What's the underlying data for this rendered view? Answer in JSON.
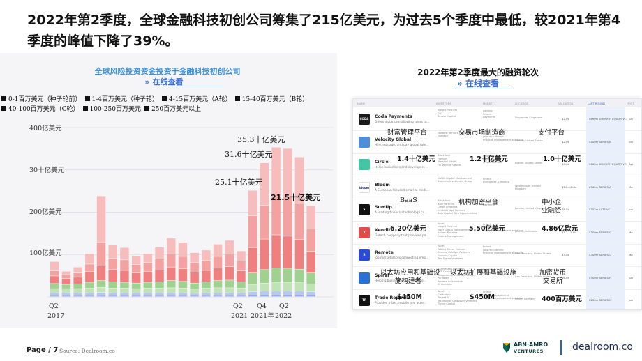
{
  "headline": "2022年第2季度，全球金融科技初创公司筹集了215亿美元，为过去5个季度中最低，较2021年第4季度的峰值下降了39%。",
  "left_chart": {
    "title": "全球风险投资资金投资于金融科技初创公司",
    "link": "» 在线查看",
    "legend": [
      "0-1百万美元（种子轮前）",
      "1-4百万美元（种子轮）",
      "4-15百万美元（A轮）",
      "15-40百万美元（B轮）",
      "40-100百万美元（C轮）",
      "100-250百万美元",
      "250百万美元以上"
    ],
    "y_ticks": [
      "400亿美元",
      "30十亿美元",
      "200亿美元",
      "100亿美元"
    ],
    "x_labels": [
      {
        "line1": "Q2",
        "line2": "2017"
      },
      {
        "line1": "Q2",
        "line2": "2021"
      },
      {
        "line1": "Q4",
        "line2": "2021年"
      },
      {
        "line1": "Q2",
        "line2": "2022"
      }
    ],
    "annotations": [
      "35.3十亿美元",
      "31.6十亿美元",
      "25.1十亿美元",
      "21.5十亿美元"
    ]
  },
  "chart_data": {
    "type": "bar",
    "stacked": true,
    "title": "全球风险投资资金投资于金融科技初创公司",
    "ylabel": "",
    "ylim": [
      0,
      40
    ],
    "unit": "十亿美元",
    "first_category": "Q2 2017",
    "last_category": "Q2 2022",
    "totals": [
      8.3,
      6.0,
      7.0,
      10.2,
      23.8,
      12.2,
      11.6,
      9.6,
      10.2,
      11.7,
      13.8,
      12.8,
      10.4,
      11.0,
      12.4,
      13.3,
      10.8,
      25.1,
      31.6,
      35.3,
      35.0,
      33.0,
      21.5
    ],
    "series": [
      {
        "name": "0-1百万美元（种子轮前）",
        "values": [
          0.3,
          0.3,
          0.3,
          0.3,
          0.3,
          0.3,
          0.3,
          0.3,
          0.3,
          0.3,
          0.3,
          0.3,
          0.3,
          0.3,
          0.3,
          0.3,
          0.3,
          0.4,
          0.4,
          0.4,
          0.4,
          0.4,
          0.4
        ]
      },
      {
        "name": "1-4百万美元（种子轮）",
        "values": [
          0.6,
          0.6,
          0.6,
          0.6,
          0.7,
          0.6,
          0.6,
          0.6,
          0.6,
          0.6,
          0.6,
          0.6,
          0.5,
          0.6,
          0.6,
          0.6,
          0.6,
          0.8,
          0.9,
          0.9,
          0.9,
          0.9,
          0.8
        ]
      },
      {
        "name": "4-15百万美元（A轮）",
        "values": [
          1.0,
          1.0,
          1.0,
          1.1,
          1.2,
          1.1,
          1.1,
          1.0,
          1.1,
          1.1,
          1.2,
          1.1,
          1.0,
          1.1,
          1.2,
          1.2,
          1.1,
          1.6,
          1.9,
          2.0,
          2.0,
          2.0,
          1.8
        ]
      },
      {
        "name": "15-40百万美元（B轮）",
        "values": [
          1.2,
          1.0,
          1.1,
          1.4,
          1.6,
          1.5,
          1.4,
          1.3,
          1.4,
          1.5,
          1.7,
          1.6,
          1.4,
          1.5,
          1.7,
          1.8,
          1.5,
          2.8,
          3.2,
          3.5,
          3.4,
          3.2,
          2.6
        ]
      },
      {
        "name": "40-100百万美元（C轮）",
        "values": [
          1.8,
          1.4,
          1.6,
          2.5,
          3.5,
          2.9,
          2.8,
          2.4,
          2.5,
          2.8,
          3.2,
          3.0,
          2.6,
          2.7,
          3.0,
          3.2,
          2.6,
          6.0,
          7.2,
          7.8,
          7.6,
          7.0,
          5.1
        ]
      },
      {
        "name": "100-250百万美元",
        "values": [
          1.2,
          0.9,
          1.0,
          1.8,
          5.5,
          2.7,
          2.5,
          2.0,
          2.2,
          2.6,
          3.1,
          2.9,
          2.3,
          2.4,
          2.7,
          3.0,
          2.3,
          7.5,
          8.0,
          9.0,
          9.2,
          8.5,
          5.3
        ]
      },
      {
        "name": "250百万美元以上",
        "values": [
          2.2,
          0.8,
          1.4,
          2.5,
          11.0,
          3.1,
          2.9,
          2.0,
          2.1,
          2.8,
          3.7,
          3.3,
          2.3,
          2.4,
          2.9,
          3.2,
          2.4,
          6.0,
          10.0,
          11.7,
          11.5,
          11.0,
          5.5
        ]
      }
    ],
    "colors": [
      "#8fb0f0",
      "#b5c8f4",
      "#bfe3b5",
      "#9fd18f",
      "#f08080",
      "#f4a1a1",
      "#f7bcbc"
    ],
    "annotations": [
      {
        "text": "35.3十亿美元",
        "value": 35.3
      },
      {
        "text": "31.6十亿美元",
        "value": 31.6
      },
      {
        "text": "25.1十亿美元",
        "value": 25.1
      },
      {
        "text": "21.5十亿美元",
        "value": 21.5
      }
    ]
  },
  "right_panel": {
    "title": "2022年第2季度最大的融资轮次",
    "link": "» 在线查看",
    "table_headers": [
      "NAME",
      "INVESTORS",
      "MARKET",
      "LOCATION",
      "VALUATION",
      "LAST ROUND",
      "FIRST"
    ],
    "rows": [
      {
        "name": "Coda Payments",
        "desc": "Offers a platform allowing users to...",
        "investors": [
          "Insight Partners",
          "GIC",
          "Smash Capital"
        ],
        "market": [
          "gaming",
          "fintech",
          "payments"
        ],
        "location": "Singapore, Singapore",
        "valuation": "$2.0b",
        "round": "$690m GROWTH EQUITY VC",
        "date": "Jun",
        "logo": "CODA",
        "logo_color": "#1a1a1a"
      },
      {
        "name": "Velocity Global",
        "desc": "Hire, manage, and pay global tale...",
        "investors": [
          "Norwest Venture Partners",
          "Eldridge"
        ],
        "market": [
          "fintech",
          "jobs recruitment",
          "financial management solutions"
        ],
        "location": "Denver, United States",
        "valuation": "$2.0b",
        "round": "$400m SERIES B",
        "date": "Jun",
        "logo": "",
        "logo_color": "#4f8ed8"
      },
      {
        "name": "Circle",
        "desc": "Helps businesses and developers ...",
        "investors": [
          "BlackRock",
          "Fidelity",
          "Marshall Wace",
          "Fin Venture Capital"
        ],
        "market": [
          "fintech",
          "payments",
          "crypto and defi"
        ],
        "location": "Boston, United States",
        "valuation": "$9.0b",
        "round": "$400m GROWTH EQUITY VC",
        "date": "Apr",
        "logo": "",
        "logo_color": "#43c5a6"
      },
      {
        "name": "Bloom",
        "desc": "A European focused small to medi...",
        "investors": [
          "Crédit Capital Management",
          "Business Investment Group"
        ],
        "market": [
          "fintech",
          "mortgages & lending"
        ],
        "location": "Westminster, United Kingdom",
        "valuation": "$1.0—2.4b",
        "round": "£360m SERIES A",
        "date": "Ma",
        "logo": "bloom",
        "logo_color": "#ffffff"
      },
      {
        "name": "SumUp",
        "desc": "A leading financial technology co...",
        "investors": [
          "BlackRock",
          "Bain Partners",
          "Crédit Investors",
          "Centerbridge Partners",
          "Bain Capital Tech Opportunities"
        ],
        "market": [
          "fintech",
          "payments"
        ],
        "location": "London, United Kingdom",
        "valuation": "$8.5b",
        "round": "$352m LATE VC",
        "date": "Jun",
        "logo": "S",
        "logo_color": "#111111"
      },
      {
        "name": "Xendit",
        "desc": "Fintech company that provides pa...",
        "investors": [
          "Accel",
          "Insight Partners",
          "Tiger Global Management",
          "Kabam Partners",
          "Coatue Management"
        ],
        "market": [
          "fintech",
          "payments",
          "financial management solutions"
        ],
        "location": "Jakarta, Indonesia",
        "valuation": "$1.2—1.8b",
        "round": "$300m SERIES D",
        "date": "Ma",
        "logo": "X",
        "logo_color": "#e04b4b"
      },
      {
        "name": "Remote",
        "desc": "Job marketplaces connecting emp...",
        "investors": [
          "Accel",
          "Adams Street Partners",
          "General Catalyst Partners",
          "Sequoia Capital",
          "Two Sigma Ventures"
        ],
        "market": [
          "fintech",
          "jobs recruitment",
          "financial management solutions"
        ],
        "location": "San Francisco, United States",
        "valuation": "$3.0b",
        "round": "$300m SERIES C",
        "date": "Ma",
        "logo": "R",
        "logo_color": "#2a4bd6"
      },
      {
        "name": "Spiral",
        "desc": "Helping businesses and creative...",
        "investors": [
          "Andreessen Horowitz",
          "NFT Capital",
          "Dragoneer Investment Group",
          "Paradigm",
          "Pantera Investments",
          "IC Ventures"
        ],
        "market": [
          "fintech",
          "crypto and defi"
        ],
        "location": "San Francisco, United States",
        "valuation": "$6.0b",
        "round": "$300m SERIES F",
        "date": "Jun",
        "logo": "",
        "logo_color": "#2a6fd6"
      },
      {
        "name": "Trade Republic",
        "desc": "Provides a fast, mobile and acce...",
        "investors": [
          "Accel",
          "Creandum",
          "Project A",
          "Technology Crossover Ventures",
          "Thrive Capital"
        ],
        "market": [
          "fintech",
          "wealth management",
          "financial management solutions"
        ],
        "location": "Berlin, Germany",
        "valuation": "$5.0b",
        "round": "€250m SERIES C",
        "date": "Jun",
        "logo": "TR",
        "logo_color": "#111111"
      }
    ],
    "overlay": {
      "row1": [
        "财富管理平台",
        "交易市场制造商",
        "支付平台"
      ],
      "row2": [
        "1.4十亿美元",
        "1.2十亿美元",
        "1.0十亿美元"
      ],
      "row3": [
        "BaaS",
        "机构加密平台",
        "中小企",
        "业融资"
      ],
      "row4": [
        "6.20亿美元",
        "5.50亿美元",
        "4.86亿欧元"
      ],
      "row5": [
        "以太坊应用和基础设",
        "施构建者",
        "以太坊扩展和基础设施",
        "加密货币",
        "交易所"
      ],
      "row6": [
        "$450M",
        "$450M",
        "400百万美元"
      ]
    }
  },
  "footer": {
    "page": "Page / 7",
    "source": "Source: Dealroom.co",
    "abn_line1": "ABN·AMRO",
    "abn_line2": "VENTURES",
    "brand": "dealroom.co"
  }
}
